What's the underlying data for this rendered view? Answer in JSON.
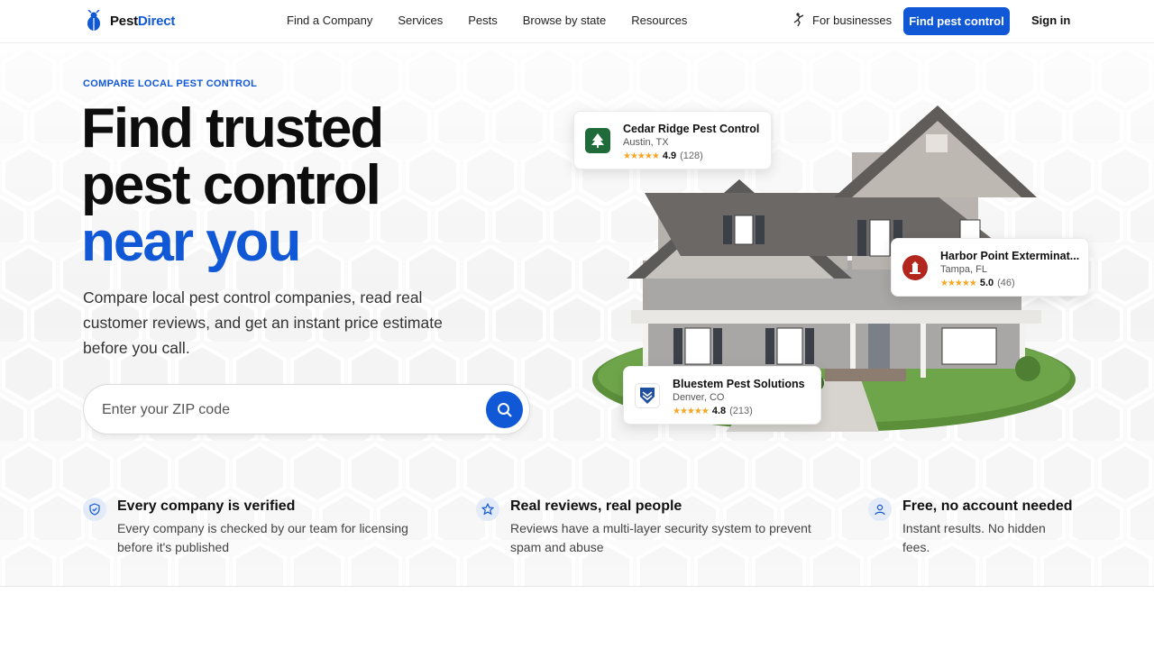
{
  "header": {
    "logo_prefix": "Pest",
    "logo_accent": "Direct",
    "nav": [
      "Find a Company",
      "Services",
      "Pests",
      "Browse by state",
      "Resources"
    ],
    "for_businesses": "For businesses",
    "cta": "Find pest control",
    "signin": "Sign in"
  },
  "hero": {
    "eyebrow": "COMPARE LOCAL PEST CONTROL",
    "headline_line1": "Find trusted",
    "headline_line2": "pest control",
    "headline_line3": "near you",
    "subtext": "Compare local pest control companies, read real customer reviews, and get an instant price estimate before you call.",
    "search_placeholder": "Enter your ZIP code"
  },
  "cards": [
    {
      "name": "Cedar Ridge Pest Control",
      "location": "Austin, TX",
      "stars": "★★★★★",
      "score": "4.9",
      "count": "(128)",
      "icon": "tree-icon",
      "color": "#1f6b3a"
    },
    {
      "name": "Harbor Point Exterminat...",
      "location": "Tampa, FL",
      "stars": "★★★★★",
      "score": "5.0",
      "count": "(46)",
      "icon": "lighthouse-icon",
      "color": "#b3261e"
    },
    {
      "name": "Bluestem Pest Solutions",
      "location": "Denver, CO",
      "stars": "★★★★★",
      "score": "4.8",
      "count": "(213)",
      "icon": "chevron-shield-icon",
      "color": "#1f4f9e"
    }
  ],
  "features": [
    {
      "title": "Every company is verified",
      "desc": "Every company is checked by our team for licensing before it's published",
      "icon": "shield-check-icon"
    },
    {
      "title": "Real reviews, real people",
      "desc": "Reviews have a multi-layer security system to prevent spam and abuse",
      "icon": "star-icon"
    },
    {
      "title": "Free, no account needed",
      "desc": "Instant results. No hidden fees.",
      "icon": "user-icon"
    }
  ],
  "colors": {
    "accent": "#1158d6",
    "star": "#f5a623"
  }
}
